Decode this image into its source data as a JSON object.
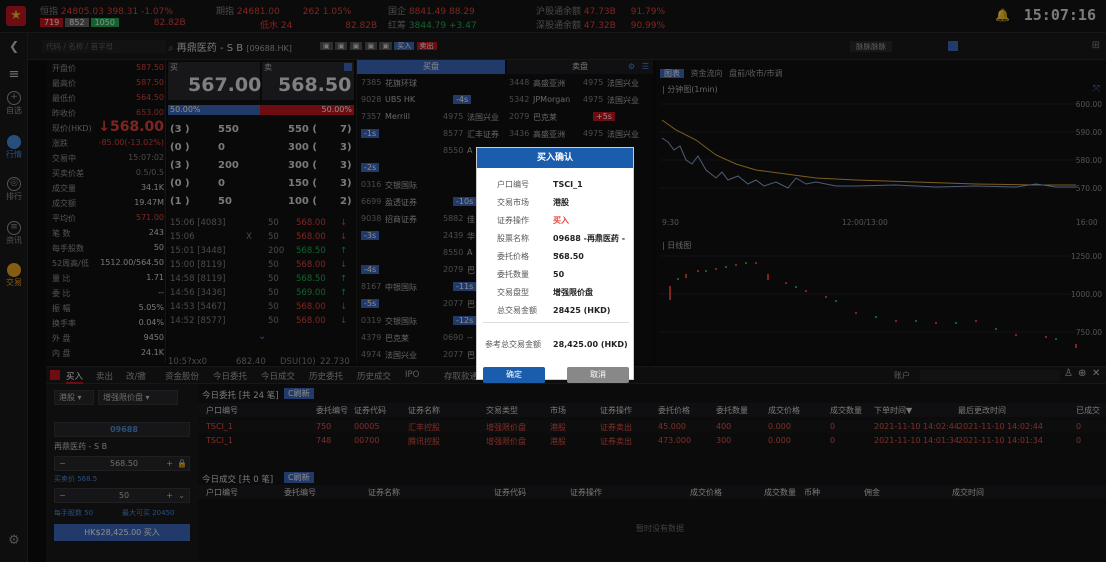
{
  "top": {
    "tickers": [
      {
        "name": "恒指",
        "value": "24805.03",
        "change": "398.31",
        "pct": "-1.07%"
      },
      {
        "name": "期指",
        "value": "24681.00",
        "change": "262",
        "pct": "1.05%"
      },
      {
        "name": "国企",
        "value": "8841.49",
        "change": "88.29"
      },
      {
        "name": "红筹",
        "value": "3844.79",
        "change": "+3.47"
      }
    ],
    "counts": [
      "719",
      "852",
      "1050"
    ],
    "turnover": "82.82B",
    "low_label": "低水",
    "low_value": "24",
    "stock_link": [
      {
        "label": "沪股通余额",
        "value": "47.73B",
        "pct": "91.79%"
      },
      {
        "label": "深股通余额",
        "value": "47.32B",
        "pct": "90.99%"
      }
    ],
    "clock": "15:07:16",
    "colors": {
      "red": "#e8443a",
      "green": "#1fb354",
      "blue": "#1a5dac"
    }
  },
  "sub": {
    "code_placeholder": "代码 / 名称 / 首字母",
    "stock_name": "再鼎医药 - S B",
    "stock_code": "[09688.HK]",
    "buy_tag": "买入",
    "sell_tag": "卖出",
    "right_item": "脉脉脉脉"
  },
  "sidebar": {
    "items": [
      "自选",
      "行情",
      "排行",
      "资讯",
      "交易"
    ]
  },
  "quote": {
    "rows": [
      {
        "l": "开盘价",
        "v": "587.50",
        "c": "red"
      },
      {
        "l": "最高价",
        "v": "587.50",
        "c": "red"
      },
      {
        "l": "最低价",
        "v": "564.50",
        "c": "red"
      },
      {
        "l": "昨收价",
        "v": "653.00",
        "c": "red"
      },
      {
        "l": "现价(HKD)",
        "v": "↓568.00",
        "c": "red"
      },
      {
        "l": "涨跌",
        "v": "-85.00(-13.02%)",
        "c": "red"
      },
      {
        "l": "交易中",
        "v": "15:07:02",
        "c": "gray"
      },
      {
        "l": "买卖价差",
        "v": "0.5/0.5",
        "c": "gray"
      },
      {
        "l": "成交量",
        "v": "34.1K",
        "c": "white"
      },
      {
        "l": "成交额",
        "v": "19.47M",
        "c": "white"
      },
      {
        "l": "平均价",
        "v": "571.00",
        "c": "red"
      },
      {
        "l": "笔 数",
        "v": "243",
        "c": "white"
      },
      {
        "l": "每手股数",
        "v": "50",
        "c": "white"
      },
      {
        "l": "52周高/低",
        "v": "1512.00/564.50",
        "c": "white"
      },
      {
        "l": "量 比",
        "v": "1.71",
        "c": "white"
      },
      {
        "l": "委 比",
        "v": "--",
        "c": "white"
      },
      {
        "l": "振 幅",
        "v": "5.05%",
        "c": "white"
      },
      {
        "l": "换手率",
        "v": "0.04%",
        "c": "white"
      },
      {
        "l": "外 盘",
        "v": "9450",
        "c": "white"
      },
      {
        "l": "内 盘",
        "v": "24.1K",
        "c": "white"
      }
    ]
  },
  "bidask": {
    "buy_label": "买",
    "sell_label": "卖",
    "bid": "567.00",
    "ask": "568.50",
    "bid_pct": "50.00%",
    "ask_pct": "50.00%",
    "queue": [
      {
        "bn": "(3 )",
        "bv": "550",
        "av": "550 (",
        "an": "7)"
      },
      {
        "bn": "(0 )",
        "bv": "0",
        "av": "300 (",
        "an": "3)"
      },
      {
        "bn": "(3 )",
        "bv": "200",
        "av": "300 (",
        "an": "3)"
      },
      {
        "bn": "(0 )",
        "bv": "0",
        "av": "150 (",
        "an": "3)"
      },
      {
        "bn": "(1 )",
        "bv": "50",
        "av": "100 (",
        "an": "2)"
      }
    ],
    "ticks": [
      {
        "t": "15:06 [4083]",
        "q": "50",
        "p": "568.00",
        "a": "↓",
        "c": "red"
      },
      {
        "t": "15:06",
        "m": "X",
        "q": "50",
        "p": "568.00",
        "a": "↓",
        "c": "red"
      },
      {
        "t": "15:01 [3448]",
        "q": "200",
        "p": "568.50",
        "a": "↑",
        "c": "green"
      },
      {
        "t": "15:00 [8119]",
        "q": "50",
        "p": "568.00",
        "a": "↓",
        "c": "red"
      },
      {
        "t": "14:58 [8119]",
        "q": "50",
        "p": "568.50",
        "a": "↑",
        "c": "green"
      },
      {
        "t": "14:56 [3436]",
        "q": "50",
        "p": "569.00",
        "a": "↑",
        "c": "green"
      },
      {
        "t": "14:53 [5467]",
        "q": "50",
        "p": "568.00",
        "a": "↓",
        "c": "red"
      },
      {
        "t": "14:52 [8577]",
        "q": "50",
        "p": "568.00",
        "a": "↓",
        "c": "red"
      }
    ],
    "tail": {
      "t": "10:5?xx0",
      "p1": "682.40",
      "n": "DSU(10)",
      "v": "22.730"
    }
  },
  "broker": {
    "buy_hdr": "买盘",
    "sell_hdr": "卖盘",
    "left": [
      {
        "a": "7385",
        "b": "花旗环球"
      },
      {
        "a": "9028",
        "b": "UBS HK",
        "t": "-4s"
      },
      {
        "a": "7357",
        "b": "Merrill",
        "c": "4975",
        "d": "法国兴业"
      },
      {
        "t": "-1s",
        "c": "8577",
        "d": "汇丰证券"
      },
      {
        "c": "8550",
        "d": "A"
      },
      {
        "t": "-2s"
      },
      {
        "a": "0316",
        "b": "交银国际"
      },
      {
        "a": "6699",
        "b": "盈透证券",
        "t": "-10s"
      },
      {
        "a": "9038",
        "b": "招商证券",
        "c": "5882",
        "d": "佳"
      },
      {
        "t": "-3s",
        "c": "2439",
        "d": "华"
      },
      {
        "c": "8550",
        "d": "A"
      },
      {
        "t": "-4s",
        "c": "2079",
        "d": "巴"
      },
      {
        "a": "8167",
        "b": "中银国际",
        "t": "-11s"
      },
      {
        "t": "-5s",
        "c": "2077",
        "d": "巴"
      },
      {
        "a": "0319",
        "b": "交银国际",
        "t": "-12s"
      },
      {
        "a": "4379",
        "b": "巴克莱",
        "c": "0690",
        "d": "--"
      },
      {
        "a": "4974",
        "b": "法国兴业",
        "c": "2077",
        "d": "巴"
      }
    ],
    "right": [
      {
        "a": "3448",
        "b": "高盛亚洲",
        "c": "4975",
        "d": "法国兴业"
      },
      {
        "a": "5342",
        "b": "JPMorgan",
        "c": "4975",
        "d": "法国兴业"
      },
      {
        "a": "2079",
        "b": "巴克莱",
        "t": "+5s"
      },
      {
        "a": "3436",
        "b": "高盛亚洲",
        "c": "4975",
        "d": "法国兴业"
      }
    ]
  },
  "chart": {
    "tabs": [
      "图表",
      "资金流向",
      "盘前/收市/市调"
    ],
    "intraday_label": "分钟图(1min)",
    "daily_label": "日线图",
    "y1": [
      "600.00",
      "590.00",
      "580.00",
      "570.00"
    ],
    "x1": [
      "9:30",
      "12:00/13:00",
      "16:00"
    ],
    "y2": [
      "1250.00",
      "1000.00",
      "750.00"
    ]
  },
  "bottom": {
    "tabs": [
      "买入",
      "卖出",
      "改/撤",
      "资金股份",
      "今日委托",
      "今日成交",
      "历史委托",
      "历史成交",
      "IPO",
      "存取款通知"
    ],
    "account_label": "账户",
    "order_header": "今日委托 [共 24 笔]",
    "refresh": "C刷新",
    "order_cols": [
      "户口编号",
      "委托编号",
      "证券代码",
      "证券名称",
      "交易类型",
      "市场",
      "证券操作",
      "委托价格",
      "委托数量",
      "成交价格",
      "成交数量",
      "下单时间▼",
      "最后更改时间",
      "已成交"
    ],
    "orders": [
      [
        "TSCI_1",
        "750",
        "00005",
        "汇丰控股",
        "增强限价盘",
        "港股",
        "证券卖出",
        "45.000",
        "400",
        "0.000",
        "0",
        "2021-11-10 14:02:44",
        "2021-11-10 14:02:44",
        "0"
      ],
      [
        "TSCI_1",
        "748",
        "00700",
        "腾讯控股",
        "增强限价盘",
        "港股",
        "证券卖出",
        "473.000",
        "300",
        "0.000",
        "0",
        "2021-11-10 14:01:34",
        "2021-11-10 14:01:34",
        "0"
      ]
    ],
    "trade_header": "今日成交 [共 0 笔]",
    "trade_cols": [
      "户口编号",
      "委托编号",
      "证券名称",
      "证券代码",
      "证券操作",
      "成交价格",
      "成交数量",
      "币种",
      "佣金",
      "成交时间"
    ],
    "empty": "暂时没有数据"
  },
  "orderform": {
    "market": "港股",
    "ordertype": "增强限价盘",
    "code": "09688",
    "name": "再鼎医药 - S B",
    "price": "568.50",
    "buy_price": "买卖价 568.5",
    "qty": "50",
    "lot": "每手股数 50",
    "max": "最大可买 20450",
    "submit": "HK$28,425.00  买入"
  },
  "dialog": {
    "title": "买入确认",
    "rows": [
      {
        "k": "户口编号",
        "v": "TSCI_1"
      },
      {
        "k": "交易市场",
        "v": "港股"
      },
      {
        "k": "证券操作",
        "v": "买入",
        "red": true
      },
      {
        "k": "股票名称",
        "v": "09688 -再鼎医药 - ..."
      },
      {
        "k": "委托价格",
        "v": "568.50"
      },
      {
        "k": "委托数量",
        "v": "50"
      },
      {
        "k": "交易盘型",
        "v": "增强限价盘"
      },
      {
        "k": "总交易金额",
        "v": "28425 (HKD)"
      }
    ],
    "ref_k": "参考总交易金额",
    "ref_v": "28,425.00 (HKD)",
    "ok": "确定",
    "cancel": "取消"
  }
}
